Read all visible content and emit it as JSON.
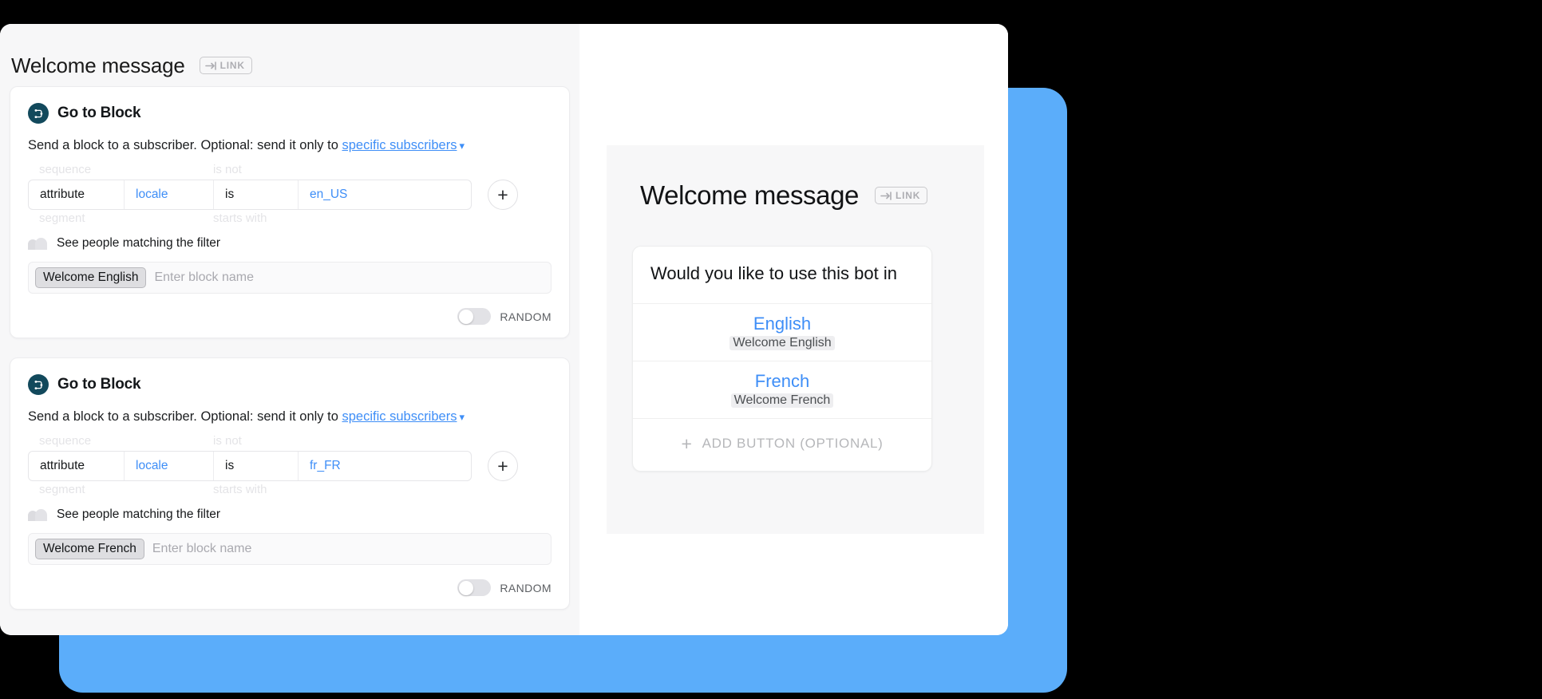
{
  "colors": {
    "accent_blue": "#3E8EF7",
    "decor_blue": "#5BADFA",
    "icon_navy": "#12495C",
    "panel_gray": "#F7F7F8",
    "background": "#000000"
  },
  "editor": {
    "title": "Welcome message",
    "link_badge": "LINK",
    "blocks": [
      {
        "icon_name": "go-to-block-icon",
        "title": "Go to Block",
        "desc_prefix": "Send a block to a subscriber. Optional: send it only to ",
        "desc_link": "specific subscribers",
        "ghost_top_left": "sequence",
        "ghost_top_mid": "is not",
        "ghost_bottom_left": "segment",
        "ghost_bottom_mid": "starts with",
        "filter": {
          "type": "attribute",
          "key": "locale",
          "operator": "is",
          "value": "en_US"
        },
        "add_condition_label": "+",
        "see_people_label": "See people matching the filter",
        "block_chip": "Welcome English",
        "block_placeholder": "Enter block name",
        "random_label": "RANDOM",
        "random_on": false
      },
      {
        "icon_name": "go-to-block-icon",
        "title": "Go to Block",
        "desc_prefix": "Send a block to a subscriber. Optional: send it only to ",
        "desc_link": "specific subscribers",
        "ghost_top_left": "sequence",
        "ghost_top_mid": "is not",
        "ghost_bottom_left": "segment",
        "ghost_bottom_mid": "starts with",
        "filter": {
          "type": "attribute",
          "key": "locale",
          "operator": "is",
          "value": "fr_FR"
        },
        "add_condition_label": "+",
        "see_people_label": "See people matching the filter",
        "block_chip": "Welcome French",
        "block_placeholder": "Enter block name",
        "random_label": "RANDOM",
        "random_on": false
      }
    ]
  },
  "preview": {
    "title": "Welcome message",
    "link_badge": "LINK",
    "message_text": "Would you like to use this bot in",
    "buttons": [
      {
        "label": "English",
        "target": "Welcome English"
      },
      {
        "label": "French",
        "target": "Welcome French"
      }
    ],
    "add_button_label": "ADD BUTTON (OPTIONAL)",
    "add_button_icon": "plus-icon"
  }
}
